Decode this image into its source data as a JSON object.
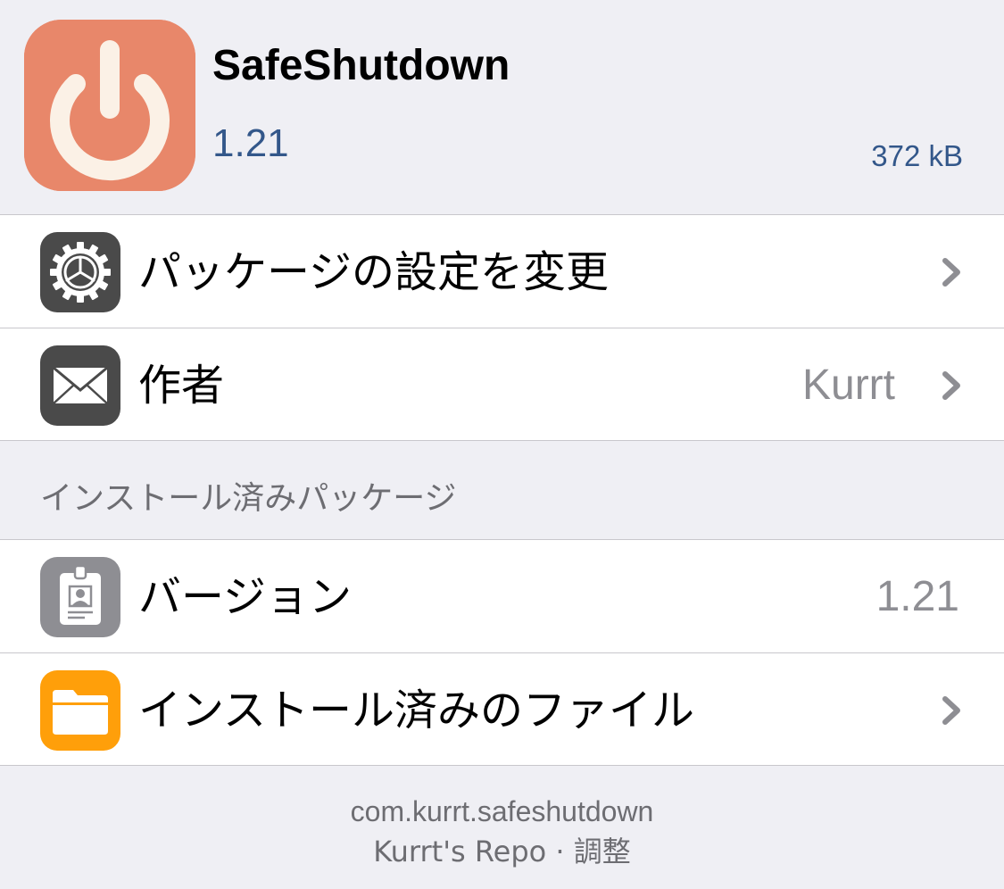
{
  "header": {
    "package_name": "SafeShutdown",
    "version": "1.21",
    "size": "372 kB",
    "icon": "power-icon",
    "icon_color": "#e8876a"
  },
  "actions": [
    {
      "label": "パッケージの設定を変更",
      "icon": "gear-icon",
      "value": ""
    },
    {
      "label": "作者",
      "icon": "mail-icon",
      "value": "Kurrt"
    }
  ],
  "installed_section": {
    "title": "インストール済みパッケージ",
    "rows": [
      {
        "label": "バージョン",
        "icon": "id-card-icon",
        "value": "1.21"
      },
      {
        "label": "インストール済みのファイル",
        "icon": "folder-icon",
        "value": ""
      }
    ]
  },
  "footer": {
    "package_id": "com.kurrt.safeshutdown",
    "repo": "Kurrt's Repo · 調整"
  },
  "colors": {
    "background": "#efeff4",
    "accent_blue": "#33578a",
    "secondary_text": "#8e8e93",
    "folder_orange": "#ff9f0a",
    "dark_icon": "#4a4a4a"
  }
}
